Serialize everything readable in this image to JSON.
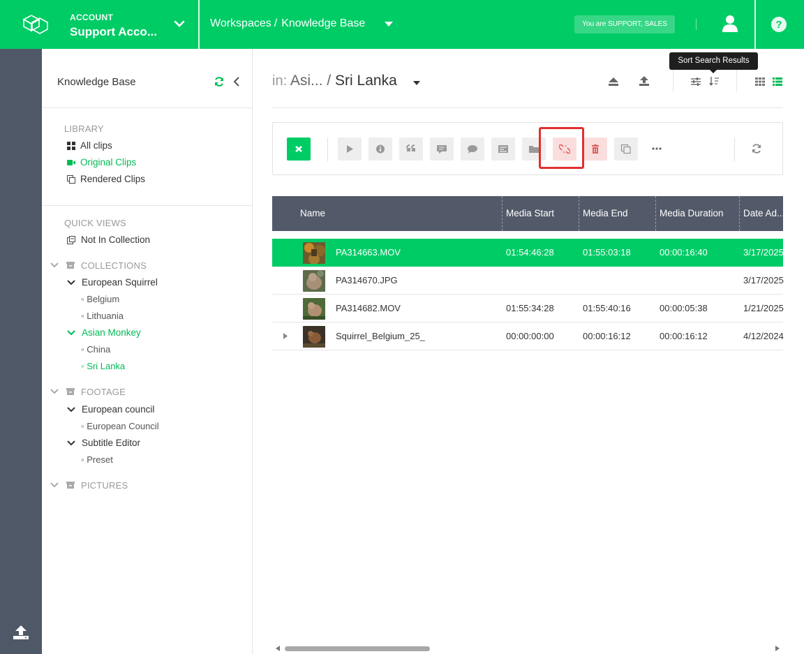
{
  "header": {
    "account_label": "ACCOUNT",
    "account_name": "Support Acco...",
    "breadcrumb": [
      "Workspaces",
      "Knowledge Base"
    ],
    "breadcrumb_sep": "/",
    "role_badge": "You are SUPPORT, SALES",
    "icons": [
      "logo-icon",
      "chevron-down-icon",
      "caret-down-icon",
      "user-icon",
      "help-icon"
    ]
  },
  "sidebar": {
    "title": "Knowledge Base",
    "library": {
      "heading": "LIBRARY",
      "items": [
        {
          "label": "All clips",
          "icon": "grid-icon",
          "active": false
        },
        {
          "label": "Original Clips",
          "icon": "video-camera-icon",
          "active": true
        },
        {
          "label": "Rendered Clips",
          "icon": "copy-icon",
          "active": false
        }
      ]
    },
    "quick_views": {
      "heading": "QUICK VIEWS",
      "items": [
        {
          "label": "Not In Collection",
          "icon": "unlinked-icon"
        }
      ]
    },
    "collections": {
      "heading": "COLLECTIONS",
      "groups": [
        {
          "label": "European Squirrel",
          "active": false,
          "children": [
            {
              "label": "Belgium",
              "active": false
            },
            {
              "label": "Lithuania",
              "active": false
            }
          ]
        },
        {
          "label": "Asian Monkey",
          "active": true,
          "children": [
            {
              "label": "China",
              "active": false
            },
            {
              "label": "Sri Lanka",
              "active": true
            }
          ]
        }
      ]
    },
    "footage": {
      "heading": "FOOTAGE",
      "groups": [
        {
          "label": "European council",
          "children": [
            {
              "label": "European Council"
            }
          ]
        },
        {
          "label": "Subtitle Editor",
          "children": [
            {
              "label": "Preset"
            }
          ]
        }
      ]
    },
    "pictures": {
      "heading": "PICTURES"
    }
  },
  "main": {
    "path_prefix": "in:",
    "path_parent": "Asi...",
    "path_sep": "/",
    "path_current": "Sri Lanka",
    "tooltip": "Sort Search Results",
    "toolbar_buttons": [
      "close-icon",
      "play-icon",
      "info-icon",
      "quote-icon",
      "comment-icon",
      "comments-icon",
      "list-icon",
      "folder-icon",
      "unlink-icon",
      "trash-icon",
      "copy-icon",
      "more-icon",
      "refresh-icon"
    ],
    "table": {
      "columns": [
        "Name",
        "Media Start",
        "Media End",
        "Media Duration",
        "Date Ad..."
      ],
      "rows": [
        {
          "name": "PA314663.MOV",
          "start": "01:54:46:28",
          "end": "01:55:03:18",
          "duration": "00:00:16:40",
          "date": "3/17/2025",
          "selected": true,
          "expandable": false
        },
        {
          "name": "PA314670.JPG",
          "start": "",
          "end": "",
          "duration": "",
          "date": "3/17/2025",
          "selected": false,
          "expandable": false
        },
        {
          "name": "PA314682.MOV",
          "start": "01:55:34:28",
          "end": "01:55:40:16",
          "duration": "00:00:05:38",
          "date": "1/21/2025",
          "selected": false,
          "expandable": false
        },
        {
          "name": "Squirrel_Belgium_25_",
          "start": "00:00:00:00",
          "end": "00:00:16:12",
          "duration": "00:00:16:12",
          "date": "4/12/2024",
          "selected": false,
          "expandable": true
        }
      ]
    }
  },
  "colors": {
    "brand_green": "#00cc66",
    "rail": "#4f5866",
    "table_header": "#525a69",
    "highlight_red": "#e03030"
  }
}
